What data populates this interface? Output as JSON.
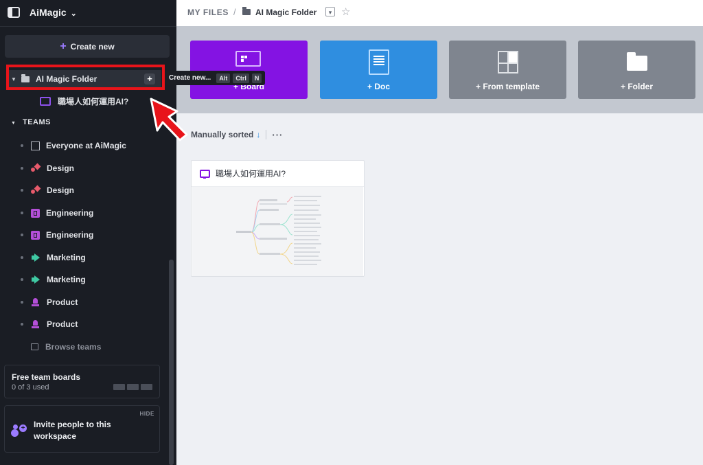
{
  "app": {
    "workspace_name": "AiMagic",
    "workspace_chevron": "⌄"
  },
  "sidebar": {
    "create_new_label": "Create new",
    "folder": {
      "name": "AI Magic Folder",
      "add_symbol": "+"
    },
    "folder_items": [
      {
        "label": "職場人如何運用AI?"
      }
    ],
    "teams_header": "TEAMS",
    "teams": [
      {
        "label": "Everyone at AiMagic",
        "icon": "building-icon"
      },
      {
        "label": "Design",
        "icon": "shapes-icon"
      },
      {
        "label": "Design",
        "icon": "shapes-icon"
      },
      {
        "label": "Engineering",
        "icon": "engineering-icon"
      },
      {
        "label": "Engineering",
        "icon": "engineering-icon"
      },
      {
        "label": "Marketing",
        "icon": "megaphone-icon"
      },
      {
        "label": "Marketing",
        "icon": "megaphone-icon"
      },
      {
        "label": "Product",
        "icon": "chess-icon"
      },
      {
        "label": "Product",
        "icon": "chess-icon"
      }
    ],
    "browse_teams_label": "Browse teams",
    "free_boards": {
      "title": "Free team boards",
      "used_text": "0 of 3 used",
      "used": 0,
      "total": 3
    },
    "invite": {
      "hide_label": "HIDE",
      "text": "Invite people to this workspace"
    }
  },
  "tooltip": {
    "label": "Create new...",
    "keys": [
      "Alt",
      "Ctrl",
      "N"
    ]
  },
  "breadcrumb": {
    "root": "MY FILES",
    "separator": "/",
    "current": "AI Magic Folder"
  },
  "create_tiles": [
    {
      "label": "+ Board",
      "color": "#8413e3",
      "icon": "board-icon"
    },
    {
      "label": "+ Doc",
      "color": "#2f8ee0",
      "icon": "doc-icon"
    },
    {
      "label": "+ From template",
      "color": "#7f858f",
      "icon": "template-icon"
    },
    {
      "label": "+ Folder",
      "color": "#7f858f",
      "icon": "folder-icon"
    }
  ],
  "sort": {
    "label": "Manually sorted",
    "arrow": "↓",
    "more": "···"
  },
  "files": [
    {
      "title": "職場人如何運用AI?",
      "type": "board"
    }
  ],
  "colors": {
    "sidebar_bg": "#1a1d24",
    "highlight": "#e8141a",
    "accent_purple": "#8413e3",
    "accent_blue": "#2f8ee0"
  }
}
